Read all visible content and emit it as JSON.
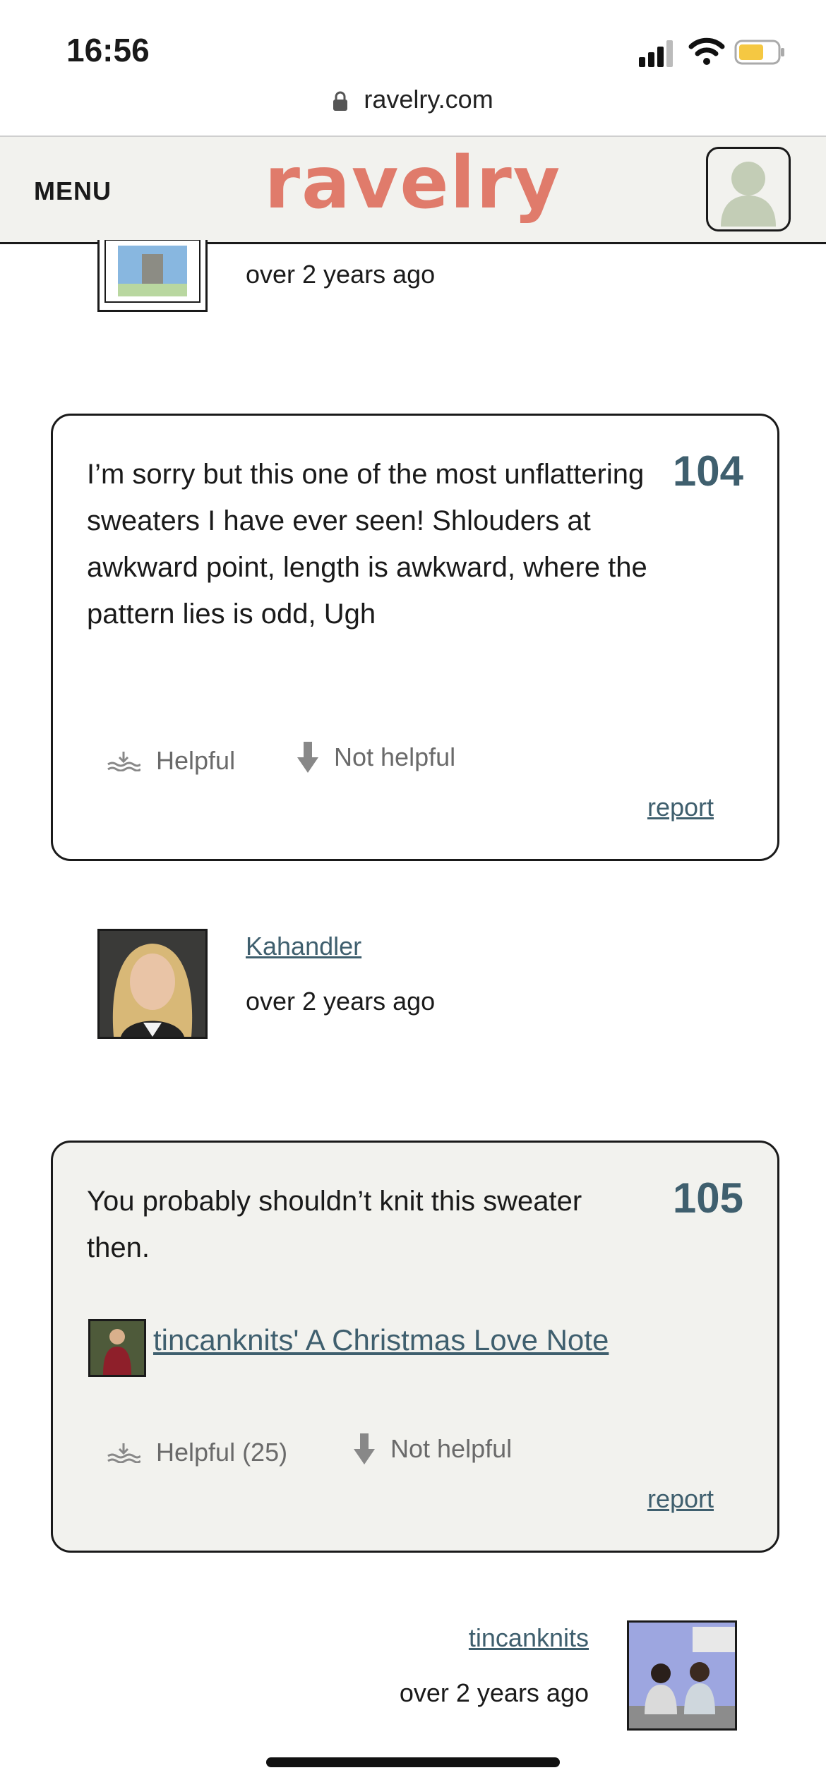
{
  "status_bar": {
    "time": "16:56",
    "icons": [
      "signal-icon",
      "wifi-icon",
      "battery-icon"
    ]
  },
  "browser": {
    "url": "ravelry.com",
    "icon": "lock-icon"
  },
  "header": {
    "menu_label": "MENU",
    "logo_text": "ravelry",
    "logo_color": "#e07b6b"
  },
  "comments": [
    {
      "time": "over 2 years ago"
    },
    {
      "number": "104",
      "text": "I’m sorry but this one of the most unflattering sweaters I have ever seen! Shlouders at awkward point, length is awkward, where the pattern lies is odd, Ugh",
      "helpful_label": "Helpful",
      "not_helpful_label": "Not helpful",
      "report_label": "report"
    },
    {
      "username": "Kahandler",
      "time": "over 2 years ago"
    },
    {
      "number": "105",
      "text": "You probably shouldn’t knit this sweater then.",
      "pattern_link": "tincanknits' A Christmas Love Note",
      "helpful_label": "Helpful (25)",
      "not_helpful_label": "Not helpful",
      "report_label": "report"
    },
    {
      "username": "tincanknits",
      "time": "over 2 years ago"
    }
  ],
  "colors": {
    "accent": "#3f5f6e",
    "card_highlight_bg": "#f2f2ee",
    "text": "#1a1a1a"
  }
}
